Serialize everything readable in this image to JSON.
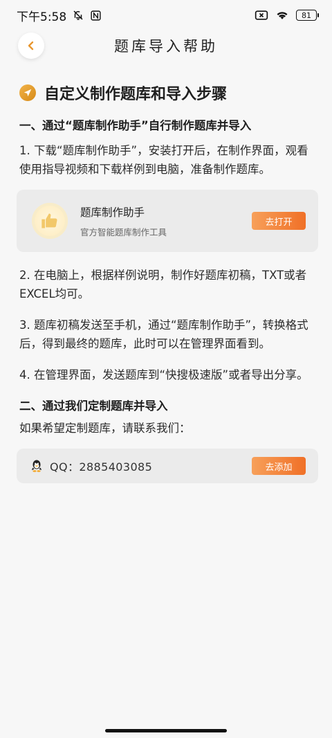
{
  "status_bar": {
    "time": "下午5:58",
    "battery": "81"
  },
  "header": {
    "title": "题库导入帮助"
  },
  "section": {
    "title": "自定义制作题库和导入步骤"
  },
  "part1": {
    "heading": "一、通过“题库制作助手”自行制作题库并导入",
    "step1": "1. 下载“题库制作助手”，安装打开后，在制作界面，观看使用指导视频和下载样例到电脑，准备制作题库。",
    "tool_card": {
      "name": "题库制作助手",
      "desc": "官方智能题库制作工具",
      "button": "去打开"
    },
    "step2": "2. 在电脑上，根据样例说明，制作好题库初稿，TXT或者EXCEL均可。",
    "step3": "3. 题库初稿发送至手机，通过“题库制作助手”，转换格式后，得到最终的题库，此时可以在管理界面看到。",
    "step4": "4. 在管理界面，发送题库到“快搜极速版”或者导出分享。"
  },
  "part2": {
    "heading": "二、通过我们定制题库并导入",
    "desc": "如果希望定制题库，请联系我们：",
    "qq": {
      "text": "QQ：2885403085",
      "button": "去添加"
    }
  },
  "colors": {
    "accent": "#f07027",
    "accent_light": "#f7a05a",
    "icon_gold": "#d68a17"
  }
}
